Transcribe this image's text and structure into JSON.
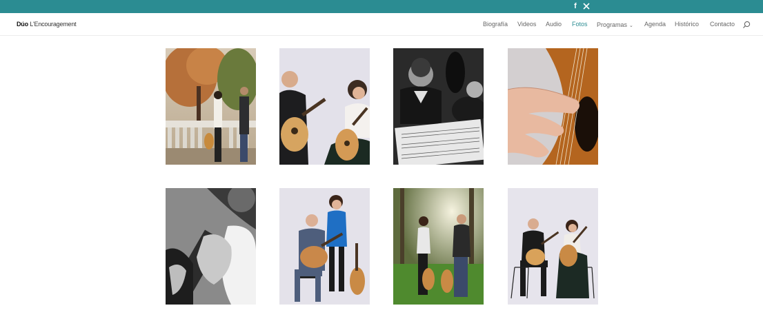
{
  "social": {
    "facebook_glyph": "f",
    "x_glyph": "𝕏"
  },
  "logo": {
    "prefix": "Dúo ",
    "name": "L'Encouragement"
  },
  "nav": {
    "items": [
      "Biografía",
      "Videos",
      "Audio",
      "Fotos",
      "Programas",
      "Agenda",
      "Histórico",
      "Contacto"
    ],
    "active": "Fotos",
    "dropdown_item": "Programas"
  },
  "icons": {
    "search": "search-icon",
    "facebook": "facebook-icon",
    "x": "x-icon",
    "dropdown": "chevron-down-icon"
  },
  "colors": {
    "accent": "#2b8c92",
    "topbar": "#2b8c92",
    "nav_text": "#666666"
  },
  "gallery": {
    "photos": [
      "autumn-park-duo",
      "duo-seated-guitars",
      "duo-sheet-music-bw",
      "hand-on-guitar-closeup",
      "hand-on-fretboard-bw",
      "duo-blue-dress-standing",
      "duo-forest-sunlight",
      "duo-chairs-black-attire"
    ]
  }
}
